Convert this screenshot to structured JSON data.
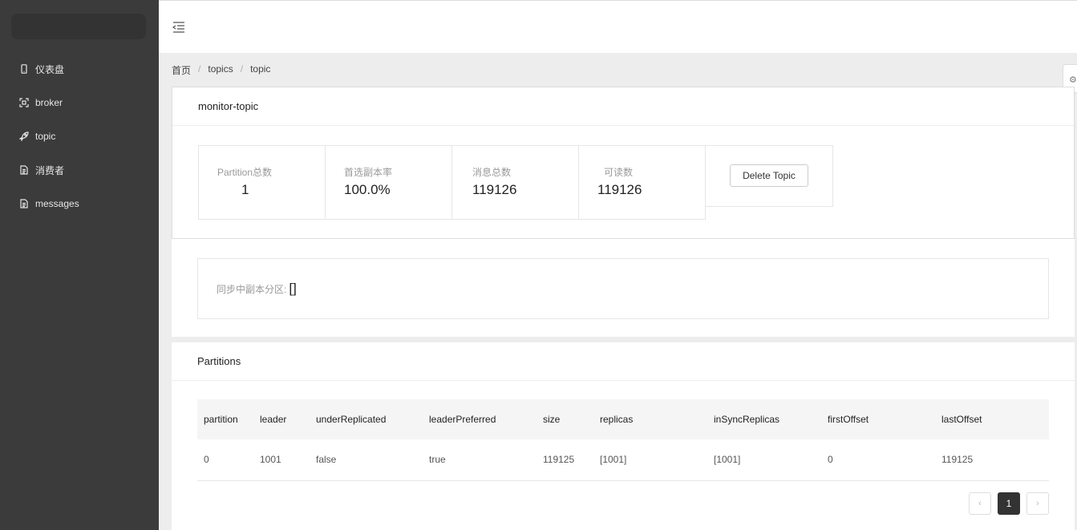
{
  "sidebar": {
    "items": [
      {
        "label": "仪表盘",
        "icon": "mobile-icon"
      },
      {
        "label": "broker",
        "icon": "scan-icon"
      },
      {
        "label": "topic",
        "icon": "rocket-icon"
      },
      {
        "label": "消费者",
        "icon": "document-icon"
      },
      {
        "label": "messages",
        "icon": "document-icon"
      }
    ]
  },
  "breadcrumb": [
    "首页",
    "topics",
    "topic"
  ],
  "topic": {
    "title": "monitor-topic",
    "stats": [
      {
        "label": "Partition总数",
        "value": "1"
      },
      {
        "label": "首选副本率",
        "value": "100.0%"
      },
      {
        "label": "消息总数",
        "value": "119126"
      },
      {
        "label": "可读数",
        "value": "119126"
      }
    ],
    "delete_label": "Delete Topic",
    "sync_label": "同步中副本分区:",
    "sync_value": "[]"
  },
  "partitions": {
    "title": "Partitions",
    "columns": [
      "partition",
      "leader",
      "underReplicated",
      "leaderPreferred",
      "size",
      "replicas",
      "inSyncReplicas",
      "firstOffset",
      "lastOffset"
    ],
    "rows": [
      [
        "0",
        "1001",
        "false",
        "true",
        "119125",
        "[1001]",
        "[1001]",
        "0",
        "119125"
      ]
    ],
    "pager": {
      "prev": "‹",
      "current": "1",
      "next": "›"
    }
  }
}
